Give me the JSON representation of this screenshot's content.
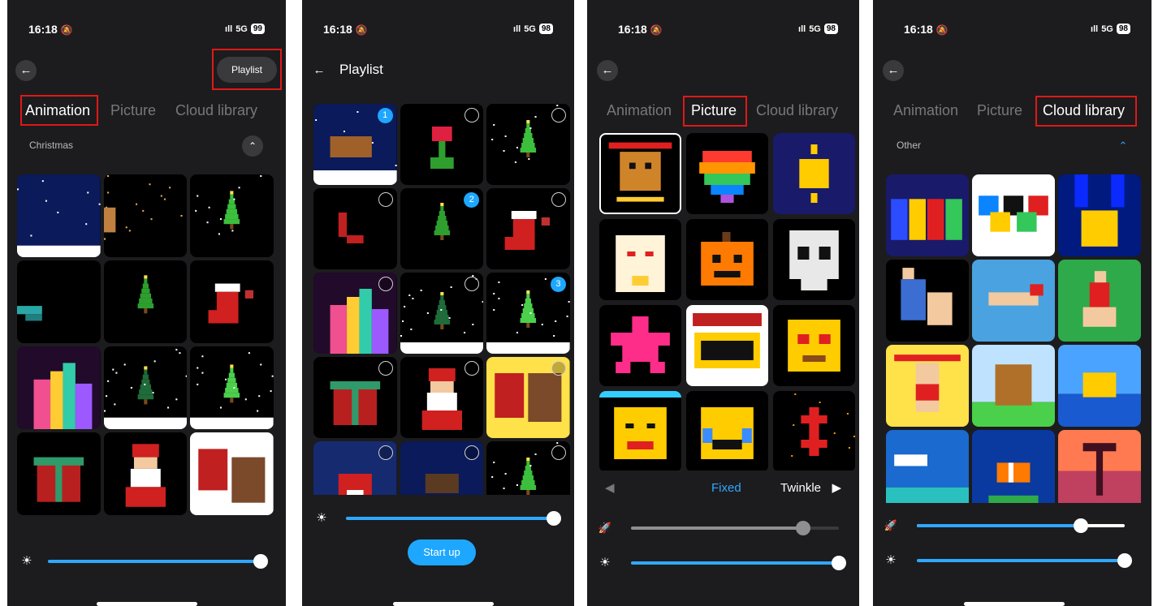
{
  "status": {
    "time": "16:18",
    "bell": "🔕",
    "signal": "ıll",
    "network": "5G"
  },
  "screen1": {
    "battery": "99",
    "back": "←",
    "playlist_button": "Playlist",
    "tabs": [
      "Animation",
      "Picture",
      "Cloud library"
    ],
    "active_tab": "Animation",
    "section_title": "Christmas",
    "collapse_icon": "⌃",
    "tiles": [
      "night-snow",
      "glitter-rain",
      "tree-small",
      "dark-swoosh",
      "green-tree",
      "stocking",
      "aurora",
      "snow-tree",
      "snow-tree-bright",
      "gift-box",
      "santa",
      "santa-reindeer"
    ]
  },
  "screen2": {
    "battery": "98",
    "back": "←",
    "title": "Playlist",
    "start_button": "Start up",
    "tiles": [
      {
        "art": "reindeer",
        "badge": "1"
      },
      {
        "art": "rose",
        "badge": ""
      },
      {
        "art": "tree-small",
        "badge": ""
      },
      {
        "art": "red-moon",
        "badge": ""
      },
      {
        "art": "green-tree",
        "badge": "2"
      },
      {
        "art": "stocking",
        "badge": ""
      },
      {
        "art": "aurora",
        "badge": ""
      },
      {
        "art": "snow-tree",
        "badge": ""
      },
      {
        "art": "snow-tree-bright",
        "badge": "3"
      },
      {
        "art": "gift-box",
        "badge": ""
      },
      {
        "art": "santa",
        "badge": ""
      },
      {
        "art": "santa-reindeer-yellow",
        "badge": ""
      },
      {
        "art": "house",
        "badge": ""
      },
      {
        "art": "reindeer-dark",
        "badge": ""
      },
      {
        "art": "tree-small",
        "badge": ""
      }
    ]
  },
  "screen3": {
    "battery": "98",
    "back": "←",
    "tabs": [
      "Animation",
      "Picture",
      "Cloud library"
    ],
    "active_tab": "Picture",
    "modes": [
      "Fixed",
      "Twinkle"
    ],
    "active_mode": "Fixed",
    "left_arrow": "◀",
    "right_arrow": "▶",
    "tiles": [
      "bear",
      "rainbow-heart",
      "sun",
      "lucky-cat",
      "pumpkin",
      "skull",
      "star",
      "sale",
      "heart-eyes",
      "smiley",
      "crying-laugh",
      "dollar"
    ]
  },
  "screen4": {
    "battery": "98",
    "back": "←",
    "tabs": [
      "Animation",
      "Picture",
      "Cloud library"
    ],
    "active_tab": "Cloud library",
    "section_title": "Other",
    "collapse_icon": "⌃",
    "tiles": [
      "2024",
      "olympic-rings",
      "gold-medal",
      "gymnast",
      "swimmer",
      "runner",
      "weightlifter",
      "dog",
      "duck",
      "sky",
      "clownfish",
      "sunset-palm"
    ]
  },
  "sliders": {
    "s1_brightness": 1.0,
    "s2_brightness": 1.0,
    "s3_speed": 0.83,
    "s3_brightness": 1.0,
    "s4_speed": 0.79,
    "s4_brightness": 1.0
  },
  "icons": {
    "brightness": "☀",
    "speed": "🚀"
  },
  "colors": {
    "accent": "#1ea7ff",
    "highlight_box": "#e01818",
    "background": "#1c1c1e"
  }
}
